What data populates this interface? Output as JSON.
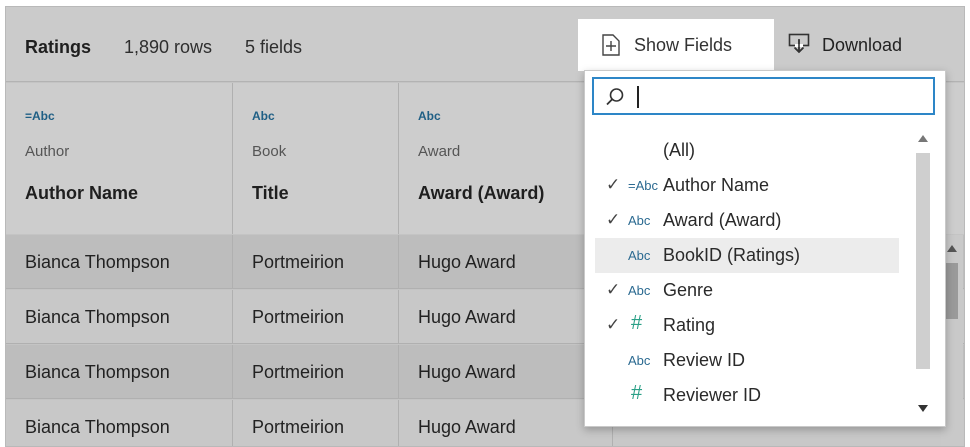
{
  "header": {
    "title": "Ratings",
    "row_count": "1,890 rows",
    "field_count": "5 fields",
    "show_fields_label": "Show Fields",
    "download_label": "Download"
  },
  "columns": [
    {
      "type": "=Abc",
      "source": "Author",
      "name": "Author Name"
    },
    {
      "type": "Abc",
      "source": "Book",
      "name": "Title"
    },
    {
      "type": "Abc",
      "source": "Award",
      "name": "Award (Award)"
    }
  ],
  "rows": [
    [
      "Bianca Thompson",
      "Portmeirion",
      "Hugo Award"
    ],
    [
      "Bianca Thompson",
      "Portmeirion",
      "Hugo Award"
    ],
    [
      "Bianca Thompson",
      "Portmeirion",
      "Hugo Award"
    ],
    [
      "Bianca Thompson",
      "Portmeirion",
      "Hugo Award"
    ]
  ],
  "dropdown": {
    "search_value": "",
    "options": [
      {
        "label": "(All)",
        "checked": false,
        "type": ""
      },
      {
        "label": "Author Name",
        "checked": true,
        "type": "=Abc"
      },
      {
        "label": "Award (Award)",
        "checked": true,
        "type": "Abc"
      },
      {
        "label": "BookID (Ratings)",
        "checked": false,
        "type": "Abc"
      },
      {
        "label": "Genre",
        "checked": true,
        "type": "Abc"
      },
      {
        "label": "Rating",
        "checked": true,
        "type": "#"
      },
      {
        "label": "Review ID",
        "checked": false,
        "type": "Abc"
      },
      {
        "label": "Reviewer ID",
        "checked": false,
        "type": "#"
      }
    ],
    "check_glyph": "✓"
  },
  "colors": {
    "accent": "#2d86c7",
    "string_type": "#2b6a91",
    "number_type": "#2aa087"
  }
}
